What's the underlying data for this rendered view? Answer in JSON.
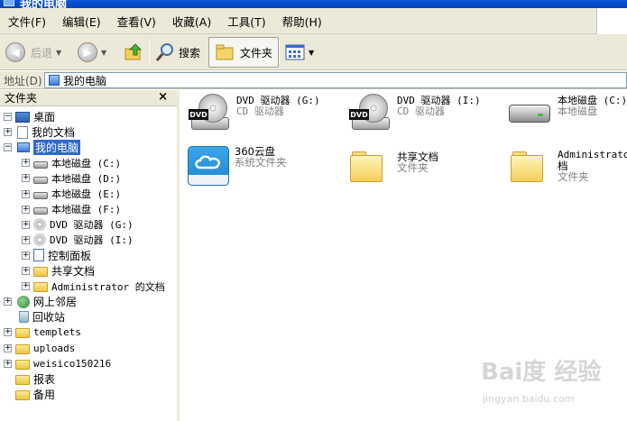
{
  "window": {
    "title": "我的电脑"
  },
  "menu": [
    "文件(F)",
    "编辑(E)",
    "查看(V)",
    "收藏(A)",
    "工具(T)",
    "帮助(H)"
  ],
  "toolbar": {
    "back": "后退",
    "search": "搜索",
    "folders": "文件夹"
  },
  "address": {
    "label": "地址(D)",
    "value": "我的电脑"
  },
  "folders_pane": {
    "title": "文件夹",
    "close": "×",
    "tree": [
      {
        "label": "桌面",
        "icon": "desktop-icon",
        "indent": 0,
        "toggle": "−"
      },
      {
        "label": "我的文档",
        "icon": "documents-icon",
        "indent": 1,
        "toggle": "+"
      },
      {
        "label": "我的电脑",
        "icon": "computer-icon",
        "indent": 1,
        "toggle": "−",
        "selected": true
      },
      {
        "label": "本地磁盘 (C:)",
        "icon": "hard-drive-icon",
        "indent": 2,
        "toggle": "+"
      },
      {
        "label": "本地磁盘 (D:)",
        "icon": "hard-drive-icon",
        "indent": 2,
        "toggle": "+"
      },
      {
        "label": "本地磁盘 (E:)",
        "icon": "hard-drive-icon",
        "indent": 2,
        "toggle": "+"
      },
      {
        "label": "本地磁盘 (F:)",
        "icon": "hard-drive-icon",
        "indent": 2,
        "toggle": "+"
      },
      {
        "label": "DVD 驱动器 (G:)",
        "icon": "dvd-drive-icon",
        "indent": 2,
        "toggle": "+"
      },
      {
        "label": "DVD 驱动器 (I:)",
        "icon": "dvd-drive-icon",
        "indent": 2,
        "toggle": "+"
      },
      {
        "label": "控制面板",
        "icon": "control-panel-icon",
        "indent": 2,
        "toggle": "+"
      },
      {
        "label": "共享文档",
        "icon": "folder-icon",
        "indent": 2,
        "toggle": "+"
      },
      {
        "label": "Administrator 的文档",
        "icon": "folder-icon",
        "indent": 2,
        "toggle": "+"
      },
      {
        "label": "网上邻居",
        "icon": "network-icon",
        "indent": 1,
        "toggle": "+"
      },
      {
        "label": "回收站",
        "icon": "recycle-bin-icon",
        "indent": 1,
        "toggle": ""
      },
      {
        "label": "templets",
        "icon": "folder-icon",
        "indent": 0,
        "toggle": "+"
      },
      {
        "label": "uploads",
        "icon": "folder-icon",
        "indent": 0,
        "toggle": "+"
      },
      {
        "label": "weisico150216",
        "icon": "folder-icon",
        "indent": 0,
        "toggle": "+"
      },
      {
        "label": "报表",
        "icon": "folder-icon",
        "indent": 0,
        "toggle": ""
      },
      {
        "label": "备用",
        "icon": "folder-icon",
        "indent": 0,
        "toggle": ""
      }
    ]
  },
  "content_items": [
    {
      "name": "DVD 驱动器 (G:)",
      "type": "CD 驱动器",
      "icon": "dvd-drive-icon"
    },
    {
      "name": "DVD 驱动器 (I:)",
      "type": "CD 驱动器",
      "icon": "dvd-drive-icon"
    },
    {
      "name": "本地磁盘 (C:)",
      "type": "本地磁盘",
      "icon": "hard-drive-icon"
    },
    {
      "name": "360云盘",
      "type": "系统文件夹",
      "icon": "cloud-drive-icon"
    },
    {
      "name": "共享文档",
      "type": "文件夹",
      "icon": "folder-icon"
    },
    {
      "name": "Administrator 的文档",
      "name_line1": "Administrator",
      "name_line2": "档",
      "type": "文件夹",
      "icon": "folder-icon"
    }
  ],
  "dvd_tag": "DVD",
  "watermark": {
    "main": "Bai度 经验",
    "url": "jingyan.baidu.com"
  }
}
